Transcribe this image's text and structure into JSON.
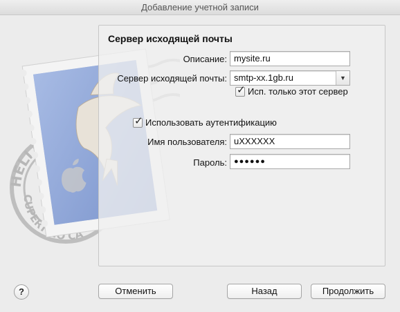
{
  "window": {
    "title": "Добавление учетной записи"
  },
  "panel": {
    "title": "Сервер исходящей почты"
  },
  "form": {
    "description": {
      "label": "Описание:",
      "value": "mysite.ru"
    },
    "server": {
      "label": "Сервер исходящей почты:",
      "value": "smtp-xx.1gb.ru"
    },
    "only_this_server": {
      "label": "Исп. только этот сервер",
      "checked": true
    },
    "use_auth": {
      "label": "Использовать аутентификацию",
      "checked": true
    },
    "username": {
      "label": "Имя пользователя:",
      "value": "uXXXXXX"
    },
    "password": {
      "label": "Пароль:",
      "value": "●●●●●●"
    }
  },
  "buttons": {
    "help": "?",
    "cancel": "Отменить",
    "back": "Назад",
    "continue": "Продолжить"
  },
  "stamp": {
    "text_top": "HELLO FR",
    "text_bottom": "CUPERTINO CA"
  },
  "icons": {
    "dropdown": "chevron-down-icon",
    "help": "question-icon",
    "check": "checkmark-icon",
    "stamp": "mail-stamp-icon"
  }
}
